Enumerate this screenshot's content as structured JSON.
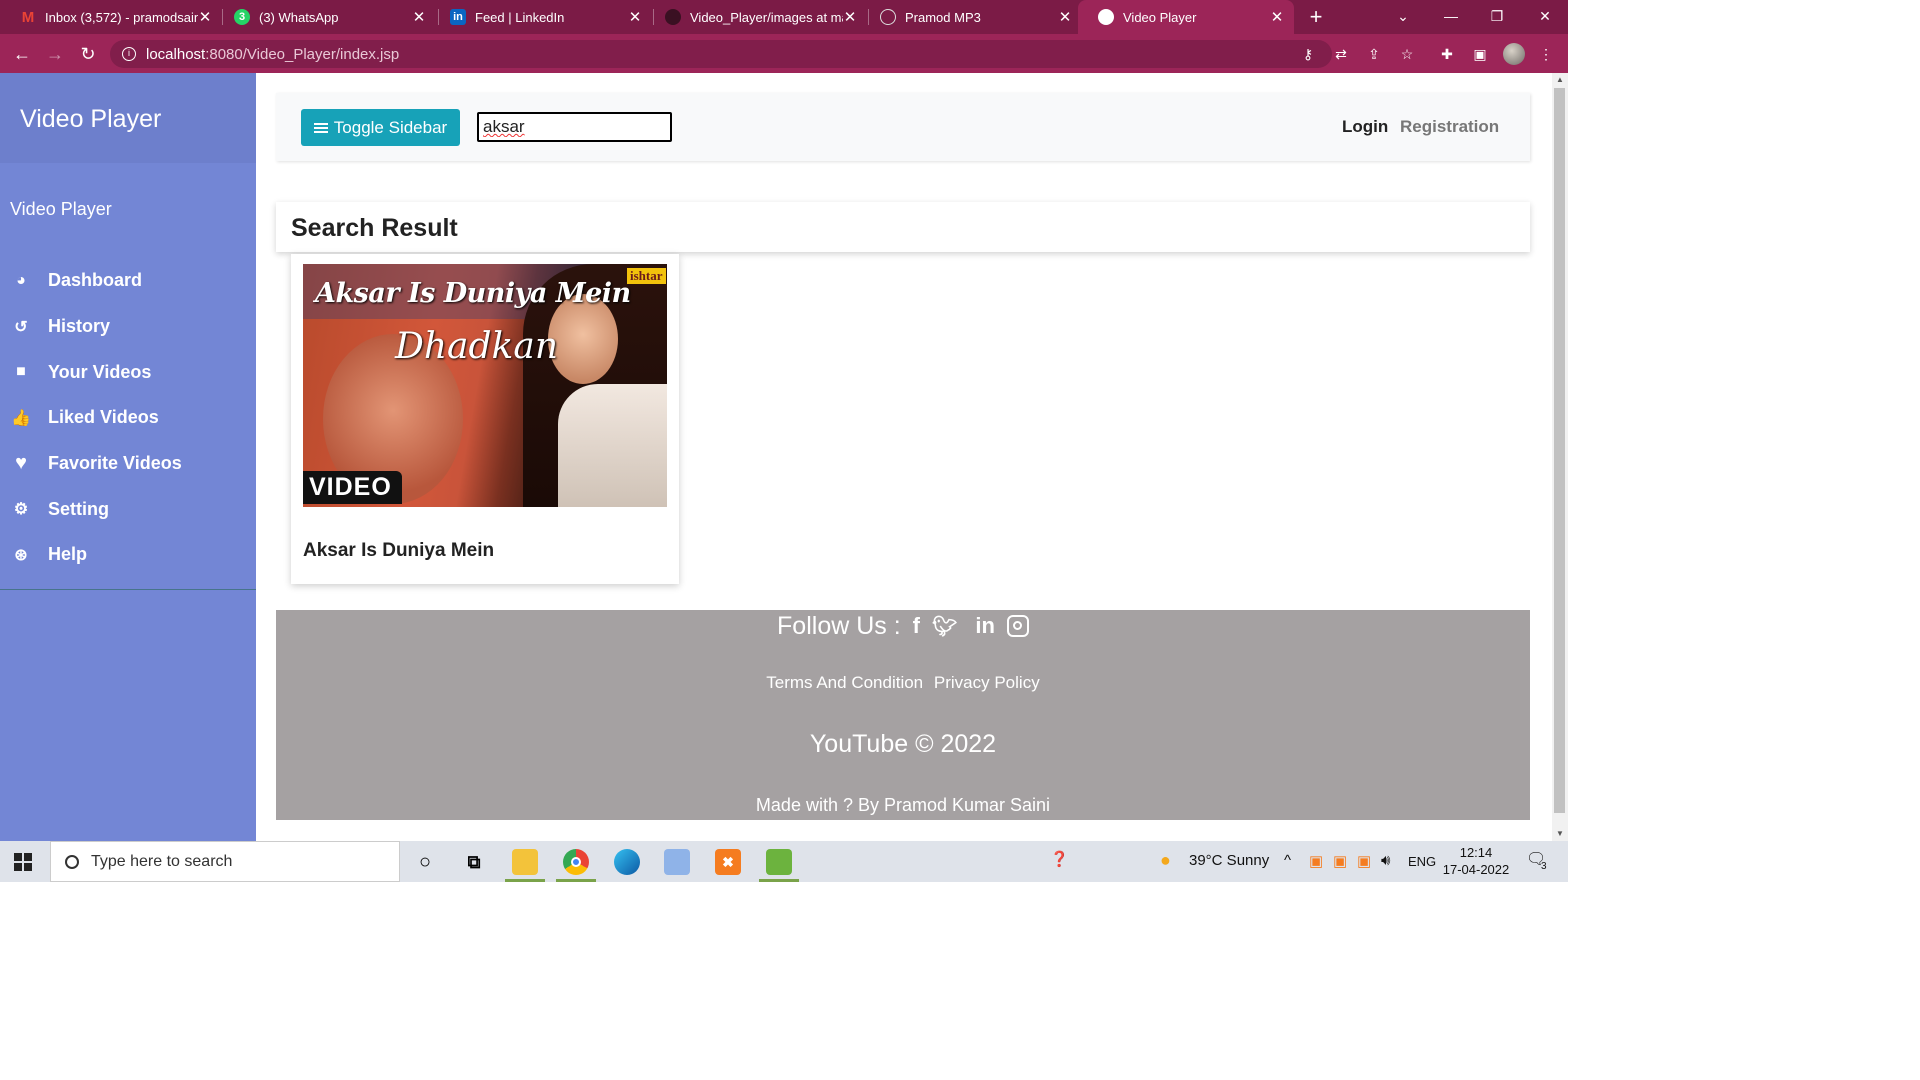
{
  "browser": {
    "tabs": [
      {
        "title": "Inbox (3,572) - pramodsaini",
        "icon": "gmail-icon"
      },
      {
        "title": "(3) WhatsApp",
        "icon": "whatsapp-icon"
      },
      {
        "title": "Feed | LinkedIn",
        "icon": "linkedin-icon"
      },
      {
        "title": "Video_Player/images at ma",
        "icon": "github-icon"
      },
      {
        "title": "Pramod MP3",
        "icon": "globe-icon"
      },
      {
        "title": "Video Player",
        "icon": "globe-icon",
        "active": true
      }
    ],
    "url_host": "localhost",
    "url_path": ":8080/Video_Player/index.jsp"
  },
  "sidebar": {
    "header": "Video Player",
    "subtitle": "Video Player",
    "items": [
      {
        "label": "Dashboard",
        "icon": "palette-icon"
      },
      {
        "label": "History",
        "icon": "history-icon"
      },
      {
        "label": "Your Videos",
        "icon": "video-camera-icon"
      },
      {
        "label": "Liked Videos",
        "icon": "thumbs-up-icon"
      },
      {
        "label": "Favorite Videos",
        "icon": "heart-icon"
      },
      {
        "label": "Setting",
        "icon": "gear-icon"
      },
      {
        "label": "Help",
        "icon": "lifebuoy-icon"
      }
    ]
  },
  "topnav": {
    "toggle_label": "Toggle Sidebar",
    "search_value": "aksar",
    "login_label": "Login",
    "registration_label": "Registration"
  },
  "results": {
    "heading": "Search Result",
    "videos": [
      {
        "title": "Aksar Is Duniya Mein",
        "thumb_title_line1": "Aksar Is Duniya Mein",
        "thumb_title_line2": "Dhadkan",
        "thumb_brand": "ishtar",
        "thumb_label": "VIDEO"
      }
    ]
  },
  "footer": {
    "follow_label": "Follow Us :",
    "social": [
      "facebook-icon",
      "twitter-icon",
      "linkedin-icon",
      "instagram-icon"
    ],
    "links": [
      "Terms And Condition",
      "Privacy Policy"
    ],
    "copyright": "YouTube © 2022",
    "made_with": "Made with ? By Pramod Kumar Saini"
  },
  "taskbar": {
    "search_placeholder": "Type here to search",
    "weather": "39°C  Sunny",
    "language": "ENG",
    "time": "12:14",
    "date": "17-04-2022",
    "notifications": "3"
  },
  "colors": {
    "chrome_tabbar": "#7b1b46",
    "chrome_toolbar": "#9c2558",
    "sidebar": "#7386d5",
    "sidebar_header": "#6d7fcc",
    "toggle_button": "#17a2b8",
    "footer": "#a5a1a2"
  }
}
